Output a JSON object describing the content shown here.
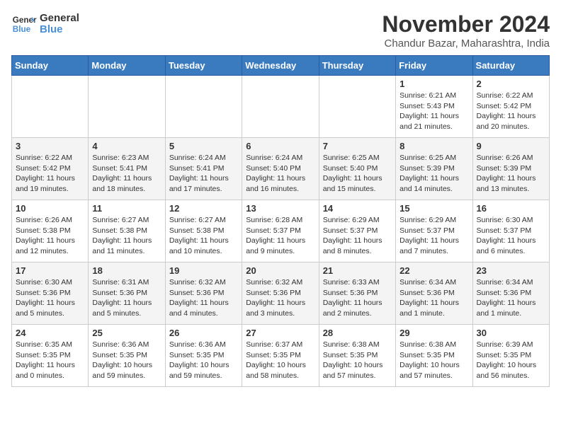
{
  "header": {
    "logo_line1": "General",
    "logo_line2": "Blue",
    "title": "November 2024",
    "subtitle": "Chandur Bazar, Maharashtra, India"
  },
  "weekdays": [
    "Sunday",
    "Monday",
    "Tuesday",
    "Wednesday",
    "Thursday",
    "Friday",
    "Saturday"
  ],
  "weeks": [
    [
      {
        "day": "",
        "info": ""
      },
      {
        "day": "",
        "info": ""
      },
      {
        "day": "",
        "info": ""
      },
      {
        "day": "",
        "info": ""
      },
      {
        "day": "",
        "info": ""
      },
      {
        "day": "1",
        "info": "Sunrise: 6:21 AM\nSunset: 5:43 PM\nDaylight: 11 hours and 21 minutes."
      },
      {
        "day": "2",
        "info": "Sunrise: 6:22 AM\nSunset: 5:42 PM\nDaylight: 11 hours and 20 minutes."
      }
    ],
    [
      {
        "day": "3",
        "info": "Sunrise: 6:22 AM\nSunset: 5:42 PM\nDaylight: 11 hours and 19 minutes."
      },
      {
        "day": "4",
        "info": "Sunrise: 6:23 AM\nSunset: 5:41 PM\nDaylight: 11 hours and 18 minutes."
      },
      {
        "day": "5",
        "info": "Sunrise: 6:24 AM\nSunset: 5:41 PM\nDaylight: 11 hours and 17 minutes."
      },
      {
        "day": "6",
        "info": "Sunrise: 6:24 AM\nSunset: 5:40 PM\nDaylight: 11 hours and 16 minutes."
      },
      {
        "day": "7",
        "info": "Sunrise: 6:25 AM\nSunset: 5:40 PM\nDaylight: 11 hours and 15 minutes."
      },
      {
        "day": "8",
        "info": "Sunrise: 6:25 AM\nSunset: 5:39 PM\nDaylight: 11 hours and 14 minutes."
      },
      {
        "day": "9",
        "info": "Sunrise: 6:26 AM\nSunset: 5:39 PM\nDaylight: 11 hours and 13 minutes."
      }
    ],
    [
      {
        "day": "10",
        "info": "Sunrise: 6:26 AM\nSunset: 5:38 PM\nDaylight: 11 hours and 12 minutes."
      },
      {
        "day": "11",
        "info": "Sunrise: 6:27 AM\nSunset: 5:38 PM\nDaylight: 11 hours and 11 minutes."
      },
      {
        "day": "12",
        "info": "Sunrise: 6:27 AM\nSunset: 5:38 PM\nDaylight: 11 hours and 10 minutes."
      },
      {
        "day": "13",
        "info": "Sunrise: 6:28 AM\nSunset: 5:37 PM\nDaylight: 11 hours and 9 minutes."
      },
      {
        "day": "14",
        "info": "Sunrise: 6:29 AM\nSunset: 5:37 PM\nDaylight: 11 hours and 8 minutes."
      },
      {
        "day": "15",
        "info": "Sunrise: 6:29 AM\nSunset: 5:37 PM\nDaylight: 11 hours and 7 minutes."
      },
      {
        "day": "16",
        "info": "Sunrise: 6:30 AM\nSunset: 5:37 PM\nDaylight: 11 hours and 6 minutes."
      }
    ],
    [
      {
        "day": "17",
        "info": "Sunrise: 6:30 AM\nSunset: 5:36 PM\nDaylight: 11 hours and 5 minutes."
      },
      {
        "day": "18",
        "info": "Sunrise: 6:31 AM\nSunset: 5:36 PM\nDaylight: 11 hours and 5 minutes."
      },
      {
        "day": "19",
        "info": "Sunrise: 6:32 AM\nSunset: 5:36 PM\nDaylight: 11 hours and 4 minutes."
      },
      {
        "day": "20",
        "info": "Sunrise: 6:32 AM\nSunset: 5:36 PM\nDaylight: 11 hours and 3 minutes."
      },
      {
        "day": "21",
        "info": "Sunrise: 6:33 AM\nSunset: 5:36 PM\nDaylight: 11 hours and 2 minutes."
      },
      {
        "day": "22",
        "info": "Sunrise: 6:34 AM\nSunset: 5:36 PM\nDaylight: 11 hours and 1 minute."
      },
      {
        "day": "23",
        "info": "Sunrise: 6:34 AM\nSunset: 5:36 PM\nDaylight: 11 hours and 1 minute."
      }
    ],
    [
      {
        "day": "24",
        "info": "Sunrise: 6:35 AM\nSunset: 5:35 PM\nDaylight: 11 hours and 0 minutes."
      },
      {
        "day": "25",
        "info": "Sunrise: 6:36 AM\nSunset: 5:35 PM\nDaylight: 10 hours and 59 minutes."
      },
      {
        "day": "26",
        "info": "Sunrise: 6:36 AM\nSunset: 5:35 PM\nDaylight: 10 hours and 59 minutes."
      },
      {
        "day": "27",
        "info": "Sunrise: 6:37 AM\nSunset: 5:35 PM\nDaylight: 10 hours and 58 minutes."
      },
      {
        "day": "28",
        "info": "Sunrise: 6:38 AM\nSunset: 5:35 PM\nDaylight: 10 hours and 57 minutes."
      },
      {
        "day": "29",
        "info": "Sunrise: 6:38 AM\nSunset: 5:35 PM\nDaylight: 10 hours and 57 minutes."
      },
      {
        "day": "30",
        "info": "Sunrise: 6:39 AM\nSunset: 5:35 PM\nDaylight: 10 hours and 56 minutes."
      }
    ]
  ]
}
